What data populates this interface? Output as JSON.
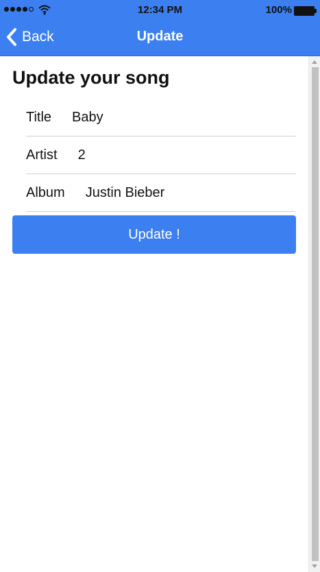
{
  "status_bar": {
    "time": "12:34 PM",
    "battery_percent": "100%",
    "signal_bars": 5,
    "signal_filled": 4,
    "icons": [
      "signal-dots-icon",
      "wifi-icon",
      "battery-icon"
    ]
  },
  "nav": {
    "back_label": "Back",
    "title": "Update",
    "back_icon": "chevron-left-icon",
    "background": "#3b7ff0"
  },
  "page": {
    "title": "Update your song"
  },
  "form": {
    "fields": [
      {
        "label": "Title",
        "value": "Baby"
      },
      {
        "label": "Artist",
        "value": "2"
      },
      {
        "label": "Album",
        "value": "Justin Bieber"
      }
    ]
  },
  "actions": {
    "update_label": "Update !",
    "accent": "#3b7ff0"
  }
}
